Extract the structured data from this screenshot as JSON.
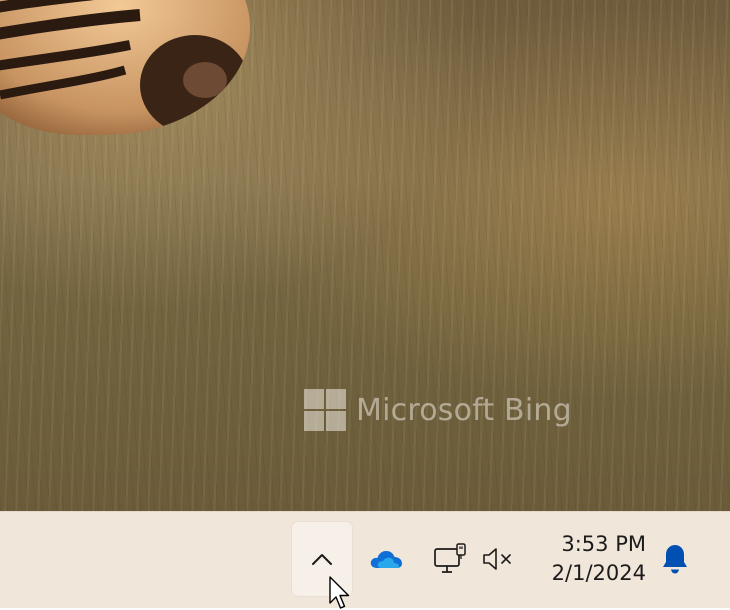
{
  "wallpaper": {
    "watermark_text": "Microsoft Bing"
  },
  "taskbar": {
    "tray": {
      "chevron_icon": "chevron-up-icon",
      "onedrive_icon": "onedrive-cloud-icon",
      "network_icon": "network-wired-icon",
      "volume_icon": "volume-muted-icon",
      "notification_icon": "notification-bell-icon"
    },
    "clock": {
      "time": "3:53 PM",
      "date": "2/1/2024"
    },
    "colors": {
      "taskbar_bg": "#f1e6da",
      "onedrive_blue": "#0f6fd6",
      "bell_blue": "#0050b3"
    }
  }
}
